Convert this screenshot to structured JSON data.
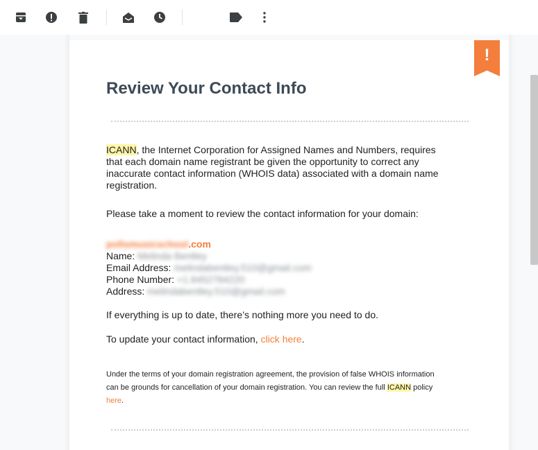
{
  "toolbar": {
    "icons": [
      "archive-icon",
      "report-spam-icon",
      "delete-icon",
      "mark-unread-icon",
      "snooze-icon",
      "label-icon",
      "more-vert-icon"
    ]
  },
  "email": {
    "badge": "!",
    "title": "Review Your Contact Info",
    "intro_highlight": "ICANN",
    "intro_rest": ", the Internet Corporation for Assigned Names and Numbers, requires that each domain name registrant be given the opportunity to correct any inaccurate contact information (WHOIS data) associated with a domain name registration.",
    "review_prompt": "Please take a moment to review the contact information for your domain:",
    "domain_blurred": "pollsmusicschool",
    "domain_suffix": ".com",
    "name_label": "Name:",
    "name_value": "Melinda Bentley",
    "email_label": "Email Address:",
    "email_value": "melindabentley.510@gmail.com",
    "phone_label": "Phone Number:",
    "phone_value": "+1.8452784220",
    "address_label": "Address:",
    "address_value": "melindabentley.510@gmail.com",
    "up_to_date": "If everything is up to date, there’s nothing more you need to do.",
    "update_prefix": "To update your contact information, ",
    "update_link": "click here",
    "update_suffix": ".",
    "terms_text": "Under the terms of your domain registration agreement, the provision of false WHOIS information can be grounds for cancellation of your domain registration. You can review the full ",
    "terms_highlight": "ICANN",
    "terms_middle": " policy ",
    "terms_link": "here",
    "terms_end": "."
  },
  "colors": {
    "accent": "#f47e3b",
    "title": "#3d4a57",
    "highlight": "#fff6a7"
  }
}
